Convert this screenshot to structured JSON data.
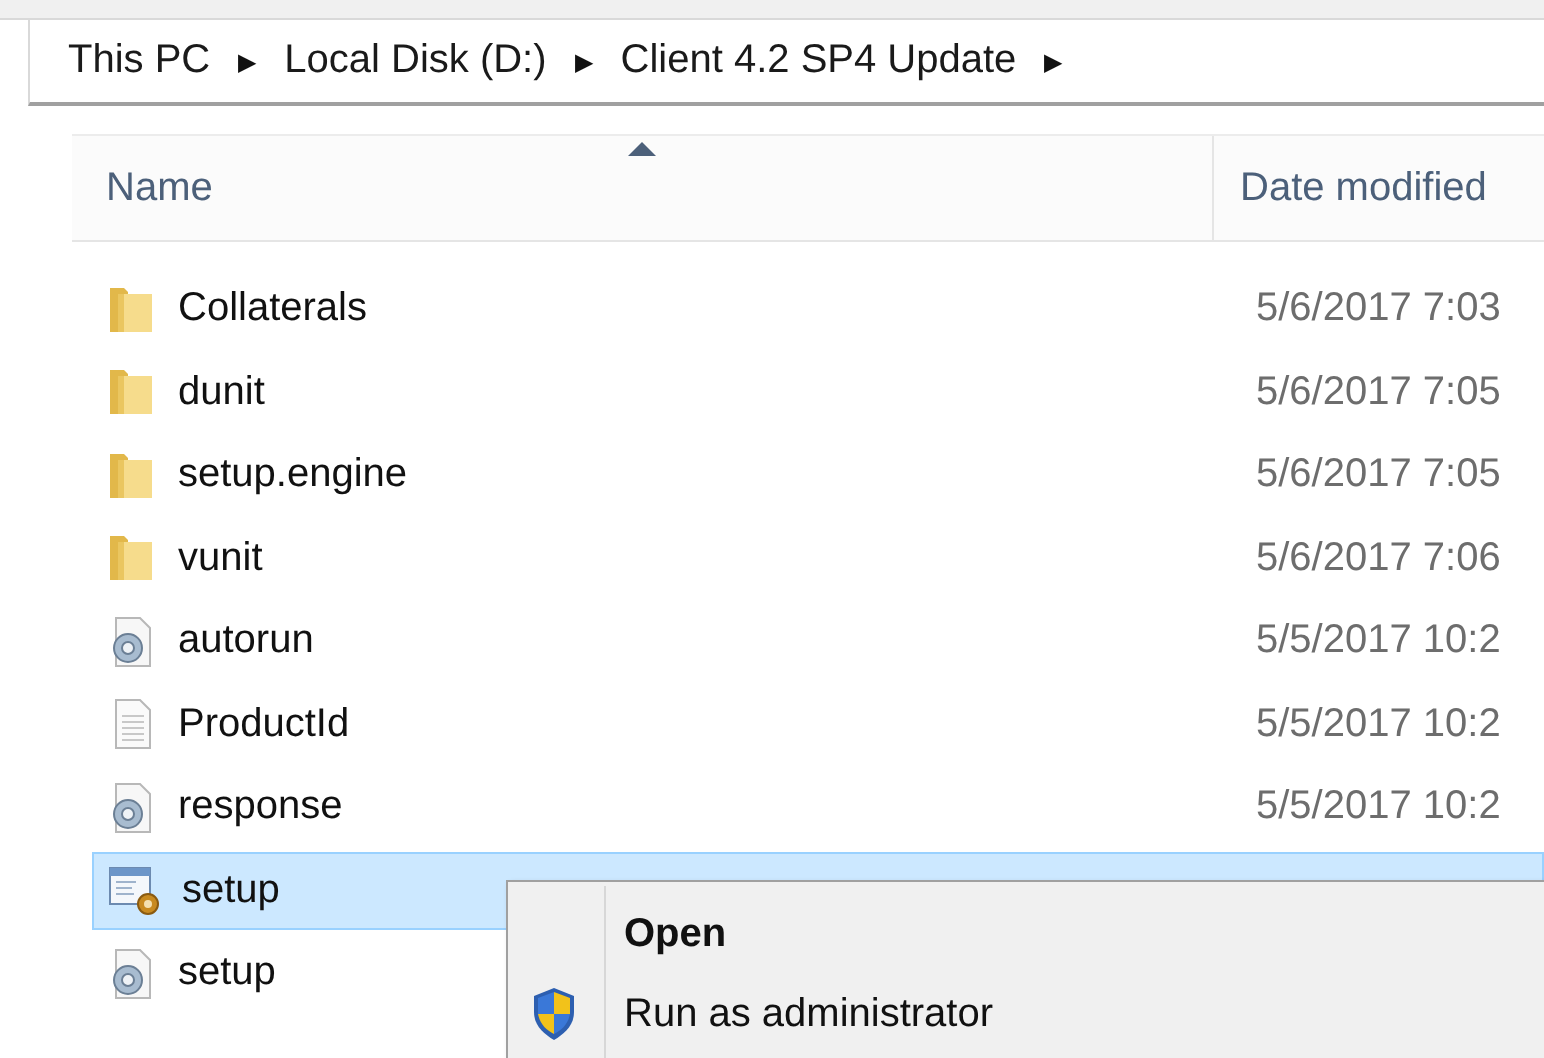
{
  "breadcrumb": [
    "This PC",
    "Local Disk (D:)",
    "Client 4.2 SP4 Update"
  ],
  "breadcrumb_separator": "▶",
  "columns": [
    {
      "label": "Name",
      "sorted": true
    },
    {
      "label": "Date modified",
      "sorted": false
    }
  ],
  "files": [
    {
      "name": "Collaterals",
      "kind": "folder",
      "date": "5/6/2017 7:03",
      "selected": false
    },
    {
      "name": "dunit",
      "kind": "folder",
      "date": "5/6/2017 7:05",
      "selected": false
    },
    {
      "name": "setup.engine",
      "kind": "folder",
      "date": "5/6/2017 7:05",
      "selected": false
    },
    {
      "name": "vunit",
      "kind": "folder",
      "date": "5/6/2017 7:06",
      "selected": false
    },
    {
      "name": "autorun",
      "kind": "settings",
      "date": "5/5/2017 10:2",
      "selected": false
    },
    {
      "name": "ProductId",
      "kind": "text",
      "date": "5/5/2017 10:2",
      "selected": false
    },
    {
      "name": "response",
      "kind": "settings",
      "date": "5/5/2017 10:2",
      "selected": false
    },
    {
      "name": "setup",
      "kind": "program",
      "selected": true
    },
    {
      "name": "setup",
      "kind": "settings",
      "selected": false
    }
  ],
  "context_menu": [
    {
      "label": "Open",
      "default": true
    },
    {
      "label": "Run as administrator",
      "default": false,
      "shield": true
    }
  ]
}
